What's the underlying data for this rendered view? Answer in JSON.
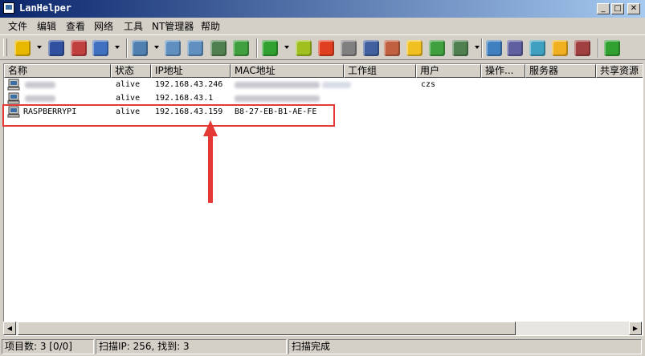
{
  "window": {
    "title": "LanHelper"
  },
  "menu": [
    "文件",
    "编辑",
    "查看",
    "网络",
    "工具",
    "NT管理器",
    "帮助"
  ],
  "toolbar_icons": [
    {
      "name": "open-folder-icon",
      "color": "#e8b800"
    },
    {
      "name": "save-icon",
      "color": "#3050a0"
    },
    {
      "name": "delete-icon",
      "color": "#c04040"
    },
    {
      "name": "filter-icon",
      "color": "#4070c0"
    },
    {
      "name": "scan-network-icon",
      "color": "#5080b0"
    },
    {
      "name": "computer-find-icon",
      "color": "#6090c0"
    },
    {
      "name": "network-computers-icon",
      "color": "#6090c0"
    },
    {
      "name": "network-share-icon",
      "color": "#508050"
    },
    {
      "name": "add-computer-icon",
      "color": "#40a040"
    },
    {
      "name": "refresh-icon",
      "color": "#30a030"
    },
    {
      "name": "wake-on-lan-icon",
      "color": "#a0c020"
    },
    {
      "name": "shutdown-icon",
      "color": "#e04020"
    },
    {
      "name": "dice-icon",
      "color": "#808080"
    },
    {
      "name": "info-icon",
      "color": "#4060a0"
    },
    {
      "name": "users-icon",
      "color": "#c06040"
    },
    {
      "name": "folder-icon",
      "color": "#f0c020"
    },
    {
      "name": "services-icon",
      "color": "#40a040"
    },
    {
      "name": "processes-icon",
      "color": "#508050"
    },
    {
      "name": "message-icon",
      "color": "#4080c0"
    },
    {
      "name": "settings-gear-icon",
      "color": "#6060a0"
    },
    {
      "name": "share-folder-icon",
      "color": "#40a0c0"
    },
    {
      "name": "open-share-icon",
      "color": "#f0b020"
    },
    {
      "name": "user-manager-icon",
      "color": "#a04040"
    },
    {
      "name": "key-login-icon",
      "color": "#30a030"
    }
  ],
  "columns": [
    "名称",
    "状态",
    "IP地址",
    "MAC地址",
    "工作组",
    "用户",
    "操作...",
    "服务器",
    "共享资源"
  ],
  "rows": [
    {
      "name": "",
      "status": "alive",
      "ip": "192.168.43.246",
      "mac": "",
      "workgroup": "",
      "user": "czs"
    },
    {
      "name": "",
      "status": "alive",
      "ip": "192.168.43.1",
      "mac": "",
      "workgroup": "",
      "user": ""
    },
    {
      "name": "RASPBERRYPI",
      "status": "alive",
      "ip": "192.168.43.159",
      "mac": "B8-27-EB-B1-AE-FE",
      "workgroup": "",
      "user": ""
    }
  ],
  "status": {
    "items": "项目数: 3 [0/0]",
    "scan": "扫描IP: 256, 找到: 3",
    "state": "扫描完成"
  },
  "annotation_color": "#e53935"
}
